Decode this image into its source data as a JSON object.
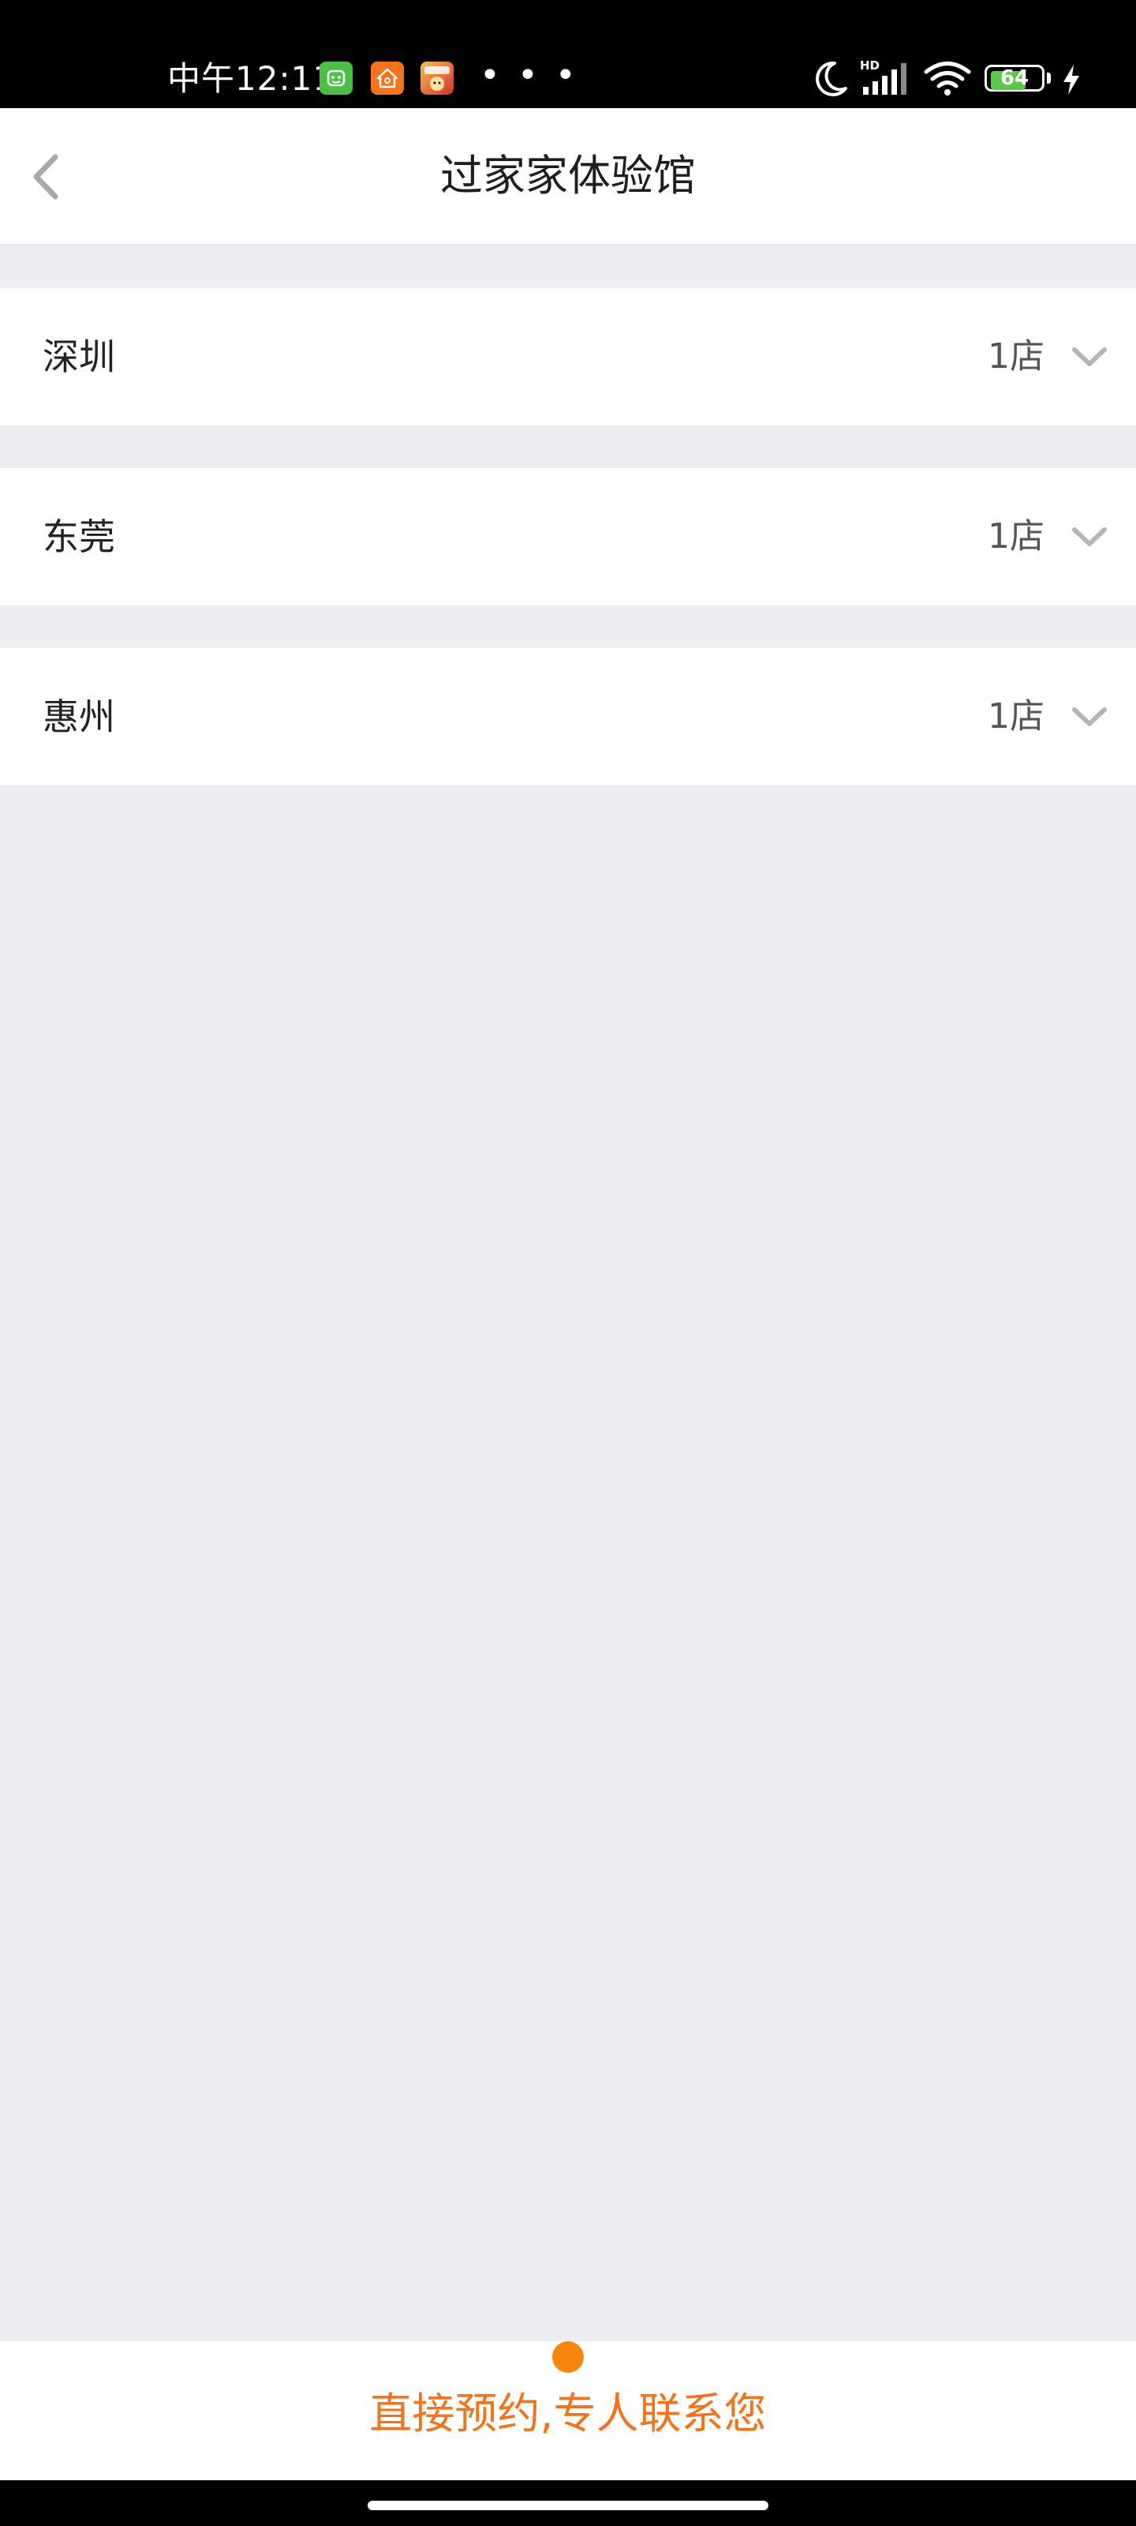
{
  "status_bar": {
    "time": "中午12:11",
    "more": "• • •",
    "battery_level": "64",
    "notification_icons": [
      "app-green-icon",
      "app-orange-home-icon",
      "game-icon"
    ],
    "right_icons": [
      "moon-icon",
      "hd-signal-icon",
      "wifi-icon",
      "battery-icon",
      "charging-icon"
    ]
  },
  "header": {
    "title": "过家家体验馆",
    "back_icon": "chevron-left-icon"
  },
  "cities": [
    {
      "name": "深圳",
      "count": "1店"
    },
    {
      "name": "东莞",
      "count": "1店"
    },
    {
      "name": "惠州",
      "count": "1店"
    }
  ],
  "bottom": {
    "cta_label": "直接预约,专人联系您"
  },
  "colors": {
    "accent": "#F2731A",
    "dot": "#F7870C",
    "background": "#ECECF1",
    "row_background": "#FFFFFF",
    "battery_fill": "#5AC84A"
  }
}
